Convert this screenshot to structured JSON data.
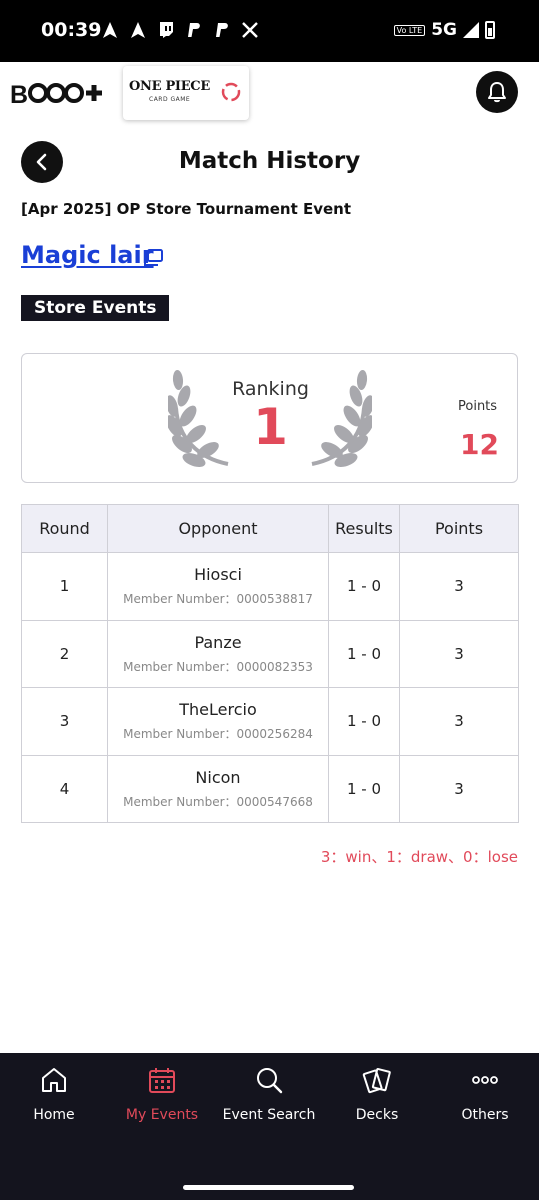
{
  "status_bar": {
    "time": "00:39",
    "volte": "Vo LTE",
    "network": "5G",
    "notification_icons": [
      "navigation-icon",
      "navigation-icon",
      "twitch-icon",
      "paypal-icon",
      "paypal-icon",
      "x-icon"
    ]
  },
  "header": {
    "brand_logo": "BNCG+",
    "game_logo_title": "ONE PIECE",
    "game_logo_subtitle": "CARD GAME",
    "bell_icon": "bell-icon"
  },
  "page": {
    "title": "Match History",
    "event_name": "[Apr 2025] OP Store Tournament Event",
    "store_name": "Magic lair",
    "event_tag": "Store Events"
  },
  "ranking": {
    "label": "Ranking",
    "value": "1",
    "points_label": "Points",
    "points_value": "12"
  },
  "table": {
    "headers": [
      "Round",
      "Opponent",
      "Results",
      "Points"
    ],
    "rows": [
      {
        "round": "1",
        "opponent": "Hiosci",
        "member": "Member Number：0000538817",
        "result": "1 - 0",
        "points": "3"
      },
      {
        "round": "2",
        "opponent": "Panze",
        "member": "Member Number：0000082353",
        "result": "1 - 0",
        "points": "3"
      },
      {
        "round": "3",
        "opponent": "TheLercio",
        "member": "Member Number：0000256284",
        "result": "1 - 0",
        "points": "3"
      },
      {
        "round": "4",
        "opponent": "Nicon",
        "member": "Member Number：0000547668",
        "result": "1 - 0",
        "points": "3"
      }
    ]
  },
  "legend": "3：win、1：draw、0：lose",
  "bottom_nav": [
    {
      "label": "Home",
      "icon": "home-icon",
      "active": false
    },
    {
      "label": "My Events",
      "icon": "calendar-icon",
      "active": true
    },
    {
      "label": "Event Search",
      "icon": "search-icon",
      "active": false
    },
    {
      "label": "Decks",
      "icon": "cards-icon",
      "active": false
    },
    {
      "label": "Others",
      "icon": "more-icon",
      "active": false
    }
  ],
  "colors": {
    "accent": "#e14a5a",
    "link": "#1a3fd6",
    "nav_bg": "#14141e",
    "table_header_bg": "#eeeef6"
  }
}
